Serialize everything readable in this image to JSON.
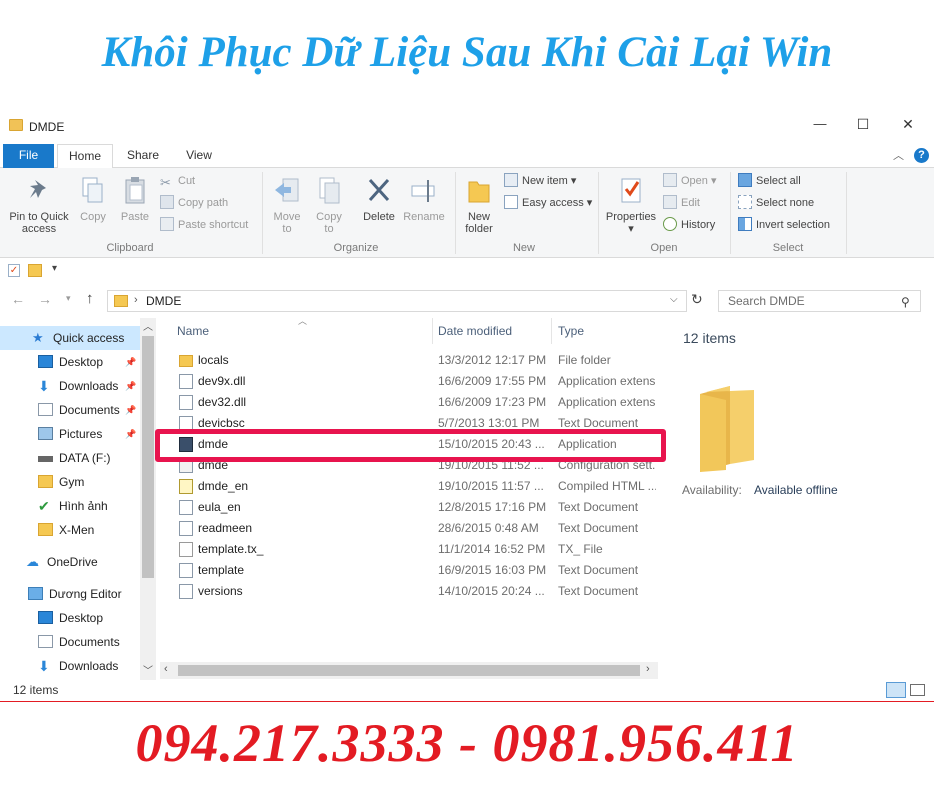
{
  "banner": {
    "title": "Khôi Phục Dữ Liệu Sau Khi Cài Lại Win",
    "phone": "094.217.3333 - 0981.956.411"
  },
  "window": {
    "title": "DMDE",
    "controls": {
      "minimize": "—",
      "maximize": "☐",
      "close": "✕"
    }
  },
  "ribbon_tabs": [
    "File",
    "Home",
    "Share",
    "View"
  ],
  "ribbon": {
    "clipboard": {
      "group": "Clipboard",
      "pin_label_1": "Pin to Quick",
      "pin_label_2": "access",
      "copy": "Copy",
      "paste": "Paste",
      "cut": "Cut",
      "copy_path": "Copy path",
      "paste_shortcut": "Paste shortcut"
    },
    "organize": {
      "group": "Organize",
      "move_to_1": "Move",
      "move_to_2": "to",
      "copy_to_1": "Copy",
      "copy_to_2": "to",
      "delete": "Delete",
      "rename": "Rename"
    },
    "new": {
      "group": "New",
      "new_folder_1": "New",
      "new_folder_2": "folder",
      "new_item": "New item",
      "easy_access": "Easy access"
    },
    "open": {
      "group": "Open",
      "properties": "Properties",
      "open": "Open",
      "edit": "Edit",
      "history": "History"
    },
    "select": {
      "group": "Select",
      "select_all": "Select all",
      "select_none": "Select none",
      "invert_selection": "Invert selection"
    }
  },
  "address": {
    "path": "DMDE",
    "search_placeholder": "Search DMDE"
  },
  "nav": {
    "items": [
      {
        "label": "Quick access",
        "icon": "star-icon",
        "pinned": false
      },
      {
        "label": "Desktop",
        "icon": "desktop-icon",
        "pinned": true
      },
      {
        "label": "Downloads",
        "icon": "downloads-icon",
        "pinned": true
      },
      {
        "label": "Documents",
        "icon": "documents-icon",
        "pinned": true
      },
      {
        "label": "Pictures",
        "icon": "pictures-icon",
        "pinned": true
      },
      {
        "label": "DATA (F:)",
        "icon": "drive-icon",
        "pinned": false
      },
      {
        "label": "Gym",
        "icon": "folder-icon",
        "pinned": false
      },
      {
        "label": "Hình ảnh",
        "icon": "check-icon",
        "pinned": false
      },
      {
        "label": "X-Men",
        "icon": "folder-icon",
        "pinned": false
      },
      {
        "label": "OneDrive",
        "icon": "onedrive-icon",
        "pinned": false
      },
      {
        "label": "Dương Editor",
        "icon": "computer-icon",
        "pinned": false
      },
      {
        "label": "Desktop",
        "icon": "desktop-icon",
        "pinned": false
      },
      {
        "label": "Documents",
        "icon": "documents-icon",
        "pinned": false
      },
      {
        "label": "Downloads",
        "icon": "downloads-icon",
        "pinned": false
      }
    ]
  },
  "file_list": {
    "columns": [
      "Name",
      "Date modified",
      "Type"
    ],
    "rows": [
      {
        "name": "locals",
        "date": "13/3/2012 12:17 PM",
        "type": "File folder",
        "icon": "folder-icon"
      },
      {
        "name": "dev9x.dll",
        "date": "16/6/2009 17:55 PM",
        "type": "Application extens",
        "icon": "dll-icon"
      },
      {
        "name": "dev32.dll",
        "date": "16/6/2009 17:23 PM",
        "type": "Application extens",
        "icon": "dll-icon"
      },
      {
        "name": "devicbsc",
        "date": "5/7/2013 13:01 PM",
        "type": "Text Document",
        "icon": "text-file-icon"
      },
      {
        "name": "dmde",
        "date": "15/10/2015 20:43 ...",
        "type": "Application",
        "icon": "app-icon"
      },
      {
        "name": "dmde",
        "date": "19/10/2015 11:52 ...",
        "type": "Configuration sett...",
        "icon": "config-icon"
      },
      {
        "name": "dmde_en",
        "date": "19/10/2015 11:57 ...",
        "type": "Compiled HTML ...",
        "icon": "help-file-icon"
      },
      {
        "name": "eula_en",
        "date": "12/8/2015 17:16 PM",
        "type": "Text Document",
        "icon": "text-file-icon"
      },
      {
        "name": "readmeen",
        "date": "28/6/2015 0:48 AM",
        "type": "Text Document",
        "icon": "text-file-icon"
      },
      {
        "name": "template.tx_",
        "date": "11/1/2014 16:52 PM",
        "type": "TX_ File",
        "icon": "blank-file-icon"
      },
      {
        "name": "template",
        "date": "16/9/2015 16:03 PM",
        "type": "Text Document",
        "icon": "text-file-icon"
      },
      {
        "name": "versions",
        "date": "14/10/2015 20:24 ...",
        "type": "Text Document",
        "icon": "text-file-icon"
      }
    ]
  },
  "details": {
    "count": "12 items",
    "availability_label": "Availability:",
    "availability_value": "Available offline"
  },
  "status": {
    "count": "12 items"
  },
  "colors": {
    "accent": "#1979ca",
    "highlight": "#e8144e",
    "banner_blue": "#1ea0e8",
    "banner_red": "#e31b23"
  }
}
